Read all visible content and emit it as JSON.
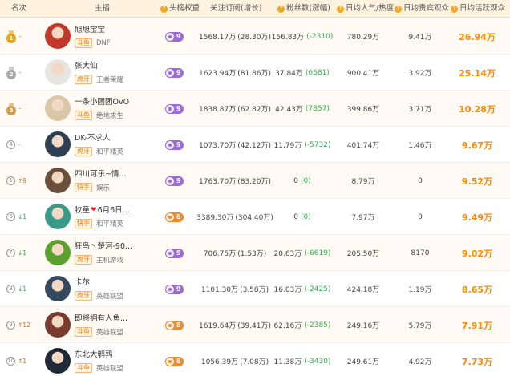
{
  "header": {
    "rank": "名次",
    "streamer": "主播",
    "weight": "头榜权重",
    "followers": "关注订阅(增长)",
    "fans": "粉丝数(涨幅)",
    "popularity": "日均人气/热度",
    "gift_viewers": "日均贵宾观众",
    "active_viewers": "日均活跃观众",
    "help_icon": "?"
  },
  "colors": {
    "accent": "#ff8a00",
    "platform_text": "#ff7f00",
    "up": "#ff6a00",
    "down": "#2bb24c",
    "badge_purple": "#9b6bd6",
    "badge_orange": "#f08a2e"
  },
  "rows": [
    {
      "rank": "1",
      "medal": "gold",
      "change": "–",
      "change_dir": "none",
      "name": "旭旭宝宝",
      "heart": "",
      "name_tail": "",
      "platform": "斗鱼",
      "category": "DNF",
      "weight": "9",
      "weight_color": "purple",
      "followers": "1568.17万",
      "followers_growth": "(28.30万)",
      "fans": "156.83万",
      "fans_change": "(-2310)",
      "popularity": "780.29万",
      "gift": "9.41万",
      "active": "26.94万",
      "avatar_hue": "#c0392b"
    },
    {
      "rank": "2",
      "medal": "silver",
      "change": "–",
      "change_dir": "none",
      "name": "张大仙",
      "heart": "",
      "name_tail": "",
      "platform": "虎牙",
      "category": "王者荣耀",
      "weight": "9",
      "weight_color": "purple",
      "followers": "1623.94万",
      "followers_growth": "(81.86万)",
      "fans": "37.84万",
      "fans_change": "(6681)",
      "popularity": "900.41万",
      "gift": "3.92万",
      "active": "25.14万",
      "avatar_hue": "#e8e4e0"
    },
    {
      "rank": "3",
      "medal": "bronze",
      "change": "–",
      "change_dir": "none",
      "name": "一条小团团OvO",
      "heart": "",
      "name_tail": "",
      "platform": "斗鱼",
      "category": "绝地求生",
      "weight": "9",
      "weight_color": "purple",
      "followers": "1838.87万",
      "followers_growth": "(62.82万)",
      "fans": "42.43万",
      "fans_change": "(7857)",
      "popularity": "399.86万",
      "gift": "3.71万",
      "active": "10.28万",
      "avatar_hue": "#d9c7a8"
    },
    {
      "rank": "4",
      "medal": "",
      "change": "–",
      "change_dir": "none",
      "name": "DK-不求人",
      "heart": "",
      "name_tail": "",
      "platform": "虎牙",
      "category": "和平精英",
      "weight": "9",
      "weight_color": "purple",
      "followers": "1073.70万",
      "followers_growth": "(42.12万)",
      "fans": "11.79万",
      "fans_change": "(-5732)",
      "popularity": "401.74万",
      "gift": "1.46万",
      "active": "9.67万",
      "avatar_hue": "#2c3e50"
    },
    {
      "rank": "5",
      "medal": "",
      "change": "9",
      "change_dir": "up",
      "name": "四川可乐~情...",
      "heart": "",
      "name_tail": "",
      "platform": "快手",
      "category": "娱乐",
      "weight": "9",
      "weight_color": "purple",
      "followers": "1763.70万",
      "followers_growth": "(83.20万)",
      "fans": "0",
      "fans_change": "(0)",
      "popularity": "8.79万",
      "gift": "0",
      "active": "9.52万",
      "avatar_hue": "#6b4f3a"
    },
    {
      "rank": "6",
      "medal": "",
      "change": "1",
      "change_dir": "down",
      "name": "牧童",
      "heart": "❤",
      "name_tail": "6月6日...",
      "platform": "快手",
      "category": "和平精英",
      "weight": "8",
      "weight_color": "orange",
      "followers": "3389.30万",
      "followers_growth": "(304.40万)",
      "fans": "0",
      "fans_change": "(0)",
      "popularity": "7.97万",
      "gift": "0",
      "active": "9.49万",
      "avatar_hue": "#3a9a8a"
    },
    {
      "rank": "7",
      "medal": "",
      "change": "1",
      "change_dir": "down",
      "name": "狂鸟丶楚河-90...",
      "heart": "",
      "name_tail": "",
      "platform": "虎牙",
      "category": "主机游戏",
      "weight": "9",
      "weight_color": "purple",
      "followers": "706.75万",
      "followers_growth": "(1.53万)",
      "fans": "20.63万",
      "fans_change": "(-6619)",
      "popularity": "205.50万",
      "gift": "8170",
      "active": "9.02万",
      "avatar_hue": "#5aa02c"
    },
    {
      "rank": "8",
      "medal": "",
      "change": "1",
      "change_dir": "down",
      "name": "卡尔",
      "heart": "",
      "name_tail": "",
      "platform": "虎牙",
      "category": "英雄联盟",
      "weight": "9",
      "weight_color": "purple",
      "followers": "1101.30万",
      "followers_growth": "(3.58万)",
      "fans": "16.03万",
      "fans_change": "(-2425)",
      "popularity": "424.18万",
      "gift": "1.19万",
      "active": "8.65万",
      "avatar_hue": "#34495e"
    },
    {
      "rank": "9",
      "medal": "",
      "change": "12",
      "change_dir": "up",
      "name": "即将拥有人鱼...",
      "heart": "",
      "name_tail": "",
      "platform": "斗鱼",
      "category": "英雄联盟",
      "weight": "8",
      "weight_color": "orange",
      "followers": "1619.64万",
      "followers_growth": "(39.41万)",
      "fans": "62.16万",
      "fans_change": "(-2385)",
      "popularity": "249.16万",
      "gift": "5.79万",
      "active": "7.91万",
      "avatar_hue": "#7a3b2e"
    },
    {
      "rank": "10",
      "medal": "",
      "change": "1",
      "change_dir": "up",
      "name": "东北大鹌鹑",
      "heart": "",
      "name_tail": "",
      "platform": "斗鱼",
      "category": "英雄联盟",
      "weight": "8",
      "weight_color": "orange",
      "followers": "1056.39万",
      "followers_growth": "(7.08万)",
      "fans": "11.38万",
      "fans_change": "(-3430)",
      "popularity": "249.61万",
      "gift": "4.92万",
      "active": "7.73万",
      "avatar_hue": "#1f2a36"
    }
  ]
}
